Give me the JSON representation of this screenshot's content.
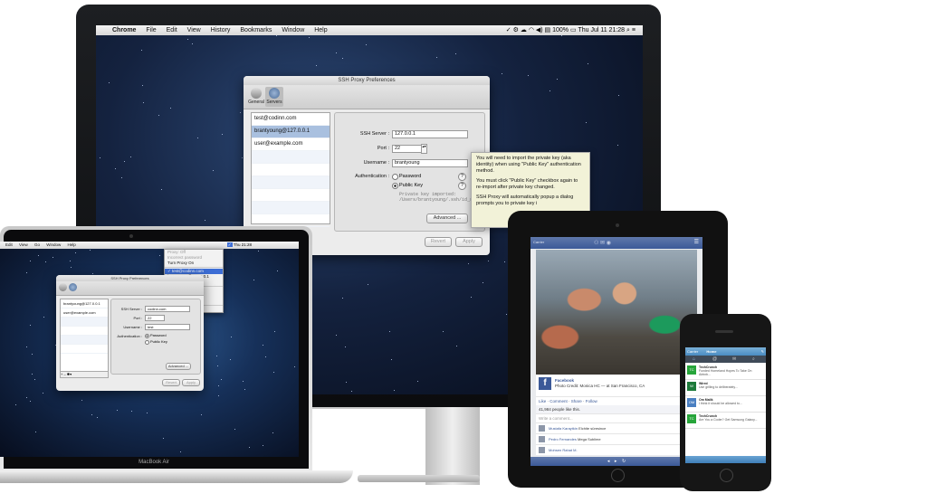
{
  "imac": {
    "menubar": {
      "apple": "",
      "app": "Chrome",
      "menus": [
        "File",
        "Edit",
        "View",
        "History",
        "Bookmarks",
        "Window",
        "Help"
      ],
      "battery": "100%",
      "clock": "Thu Jul 11  21:28"
    },
    "prefs": {
      "title": "SSH Proxy Preferences",
      "tabs": [
        "General",
        "Servers"
      ],
      "selected_tab": "Servers",
      "servers": [
        "test@codinn.com",
        "brantyoung@127.0.0.1",
        "user@example.com"
      ],
      "selected_server": 1,
      "labels": {
        "ssh_server": "SSH Server :",
        "port": "Port :",
        "username": "Username :",
        "authentication": "Authentication :"
      },
      "values": {
        "ssh_server": "127.0.0.1",
        "port": "22",
        "username": "brantyoung"
      },
      "auth_options": [
        "Password",
        "Public Key"
      ],
      "auth_selected": "Public Key",
      "key_note": "Private key imported: /Users/brantyoung/.ssh/id_rsa",
      "advanced_button": "Advanced ...",
      "revert_button": "Revert",
      "apply_button": "Apply",
      "help_glyph": "?",
      "tooltip": [
        "You will need to import the private key (aka identity) when using \"Public Key\" authentication method.",
        "You must click \"Public Key\" checkbox again to re-import after private key changed.",
        "SSH Proxy will automatically popup a dialog prompts you to private key i"
      ]
    },
    "logo_glyph": ""
  },
  "macbook": {
    "label": "MacBook Air",
    "menubar": {
      "menus": [
        "Edit",
        "View",
        "Go",
        "Window",
        "Help"
      ],
      "clock": "Thu 21:28"
    },
    "dropdown": [
      {
        "label": "Proxy: Off",
        "style": "dim"
      },
      {
        "label": "Incorrect password",
        "style": "dim"
      },
      {
        "label": "Turn Proxy On",
        "style": "normal"
      },
      {
        "label": "",
        "style": "sep"
      },
      {
        "label": "✓ test@codinn.com",
        "style": "sel"
      },
      {
        "label": "brantyoung@127.0.0.1",
        "style": "normal"
      },
      {
        "label": "user@example.com",
        "style": "normal"
      },
      {
        "label": "",
        "style": "sep"
      },
      {
        "label": "Preferences...",
        "style": "normal"
      },
      {
        "label": "Help",
        "style": "normal"
      },
      {
        "label": "About SSH Proxy",
        "style": "normal"
      },
      {
        "label": "",
        "style": "sep"
      },
      {
        "label": "Quit",
        "style": "normal"
      }
    ],
    "prefs": {
      "title": "SSH Proxy Preferences",
      "servers": [
        "brantyoung@127.0.0.1",
        "user@example.com"
      ],
      "labels": {
        "ssh_server": "SSH Server :",
        "port": "Port :",
        "username": "Username :",
        "authentication": "Authentication :"
      },
      "values": {
        "ssh_server": "codinn.com",
        "port": "22",
        "username": "test"
      },
      "auth_options": [
        "Password",
        "Public Key"
      ],
      "advanced_button": "Advanced ...",
      "revert_button": "Revert",
      "apply_button": "Apply",
      "list_controls": "+ –  ✱▾"
    }
  },
  "ipad": {
    "status_left": "Carrier",
    "post": {
      "title": "Facebook",
      "subtitle": "Photo Credit: Monica HC — at San Francisco, CA",
      "actions": [
        "Like",
        "Comment",
        "Share",
        "Follow"
      ],
      "likes": "41,984 people like this.",
      "comment_placeholder": "Write a comment...",
      "comments": [
        {
          "name": "Mustafa Karaytkin",
          "text": "Elchite süresince",
          "meta": "Like · Reply · July 10"
        },
        {
          "name": "Pedro Fernandes",
          "text": "Mega Sublime",
          "meta": "Like · Reply · July 11"
        },
        {
          "name": "Mohsen Rahat M.",
          "text": "",
          "meta": ""
        }
      ]
    }
  },
  "iphone": {
    "carrier": "Carrier",
    "title": "Home",
    "tweets": [
      {
        "name": "TechCrunch",
        "text": "Funded Homeland Hopes To Take On Airbnb...",
        "color": "#27a53a",
        "glyph": "TC"
      },
      {
        "name": "Wired",
        "text": "Use grilling to deliberately...",
        "color": "#1d7a3a",
        "glyph": "W"
      },
      {
        "name": "Om Malik",
        "text": "I think it should be allowed to...",
        "color": "#4a7fc1",
        "glyph": "OM"
      },
      {
        "name": "TechCrunch",
        "text": "Are You a Coder? Get Samsung Galaxy...",
        "color": "#27a53a",
        "glyph": "TC"
      }
    ]
  }
}
